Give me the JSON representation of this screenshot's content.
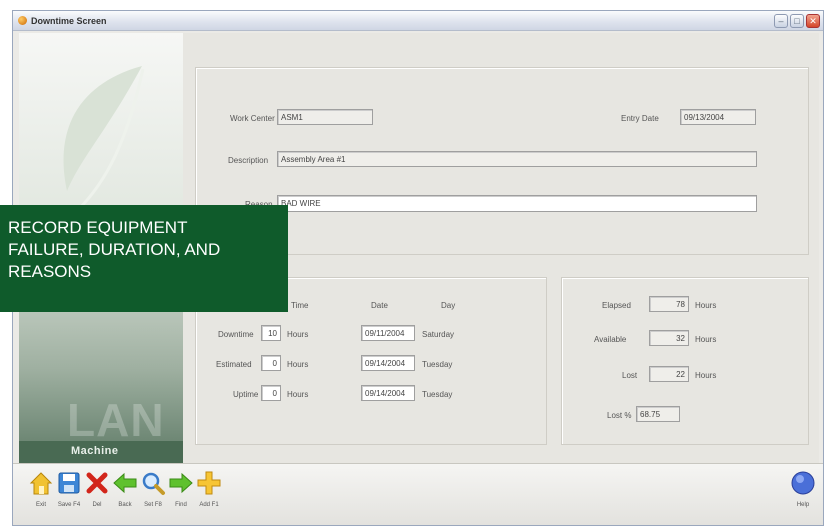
{
  "window": {
    "title": "Downtime Screen",
    "minimize": "–",
    "maximize": "□",
    "close": "✕"
  },
  "sidebar": {
    "logo_text": "LAN",
    "caption": "Machine"
  },
  "header": {
    "work_center_label": "Work Center",
    "work_center_value": "ASM1",
    "entry_date_label": "Entry Date",
    "entry_date_value": "09/13/2004",
    "description_label": "Description",
    "description_value": "Assembly Area #1",
    "reason_label": "Reason",
    "reason_value": "BAD WIRE"
  },
  "times": {
    "col_time": "Time",
    "col_date": "Date",
    "col_day": "Day",
    "rows": [
      {
        "label": "Downtime",
        "hours": "10",
        "unit": "Hours",
        "date": "09/11/2004",
        "day": "Saturday"
      },
      {
        "label": "Estimated",
        "hours": "0",
        "unit": "Hours",
        "date": "09/14/2004",
        "day": "Tuesday"
      },
      {
        "label": "Uptime",
        "hours": "0",
        "unit": "Hours",
        "date": "09/14/2004",
        "day": "Tuesday"
      }
    ]
  },
  "stats": {
    "elapsed_label": "Elapsed",
    "elapsed_value": "78",
    "elapsed_unit": "Hours",
    "available_label": "Available",
    "available_value": "32",
    "available_unit": "Hours",
    "lost_label": "Lost",
    "lost_value": "22",
    "lost_unit": "Hours",
    "lost_pct_label": "Lost %",
    "lost_pct_value": "68.75"
  },
  "toolbar": {
    "exit": "Exit",
    "save": "Save F4",
    "del": "Del",
    "back": "Back",
    "set": "Set F8",
    "find": "Find",
    "add": "Add F1",
    "help": "Help"
  },
  "banner": {
    "line1": "RECORD EQUIPMENT",
    "line2": "FAILURE, DURATION, AND",
    "line3": "REASONS"
  }
}
